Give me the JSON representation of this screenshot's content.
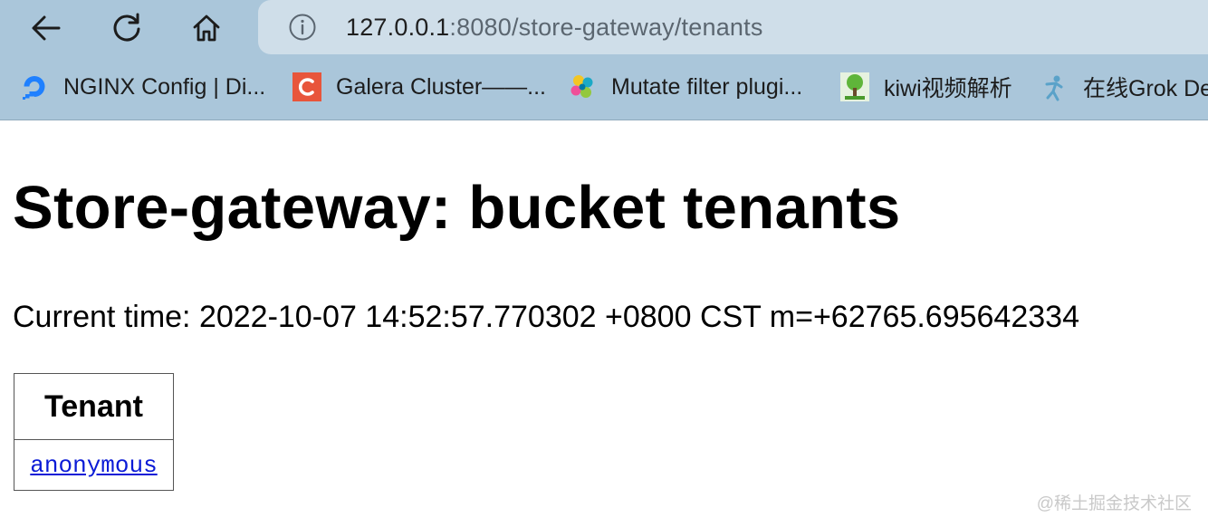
{
  "browser": {
    "url": {
      "host": "127.0.0.1",
      "path": ":8080/store-gateway/tenants"
    },
    "bookmarks": [
      {
        "label": "NGINX Config | Di...",
        "icon": "digitalocean-icon"
      },
      {
        "label": "Galera Cluster——...",
        "icon": "letter-c-icon"
      },
      {
        "label": "Mutate filter plugi...",
        "icon": "elastic-icon"
      },
      {
        "label": "kiwi视频解析",
        "icon": "tree-icon"
      },
      {
        "label": "在线Grok De",
        "icon": "grok-icon"
      }
    ]
  },
  "page": {
    "title": "Store-gateway: bucket tenants",
    "current_time": "Current time: 2022-10-07 14:52:57.770302 +0800 CST m=+62765.695642334",
    "table": {
      "header": "Tenant",
      "rows": [
        "anonymous"
      ]
    }
  },
  "watermark": "@稀土掘金技术社区",
  "colors": {
    "chrome": "#aac6da",
    "urlbar": "#cfdee9",
    "link": "#0b1bd6"
  }
}
